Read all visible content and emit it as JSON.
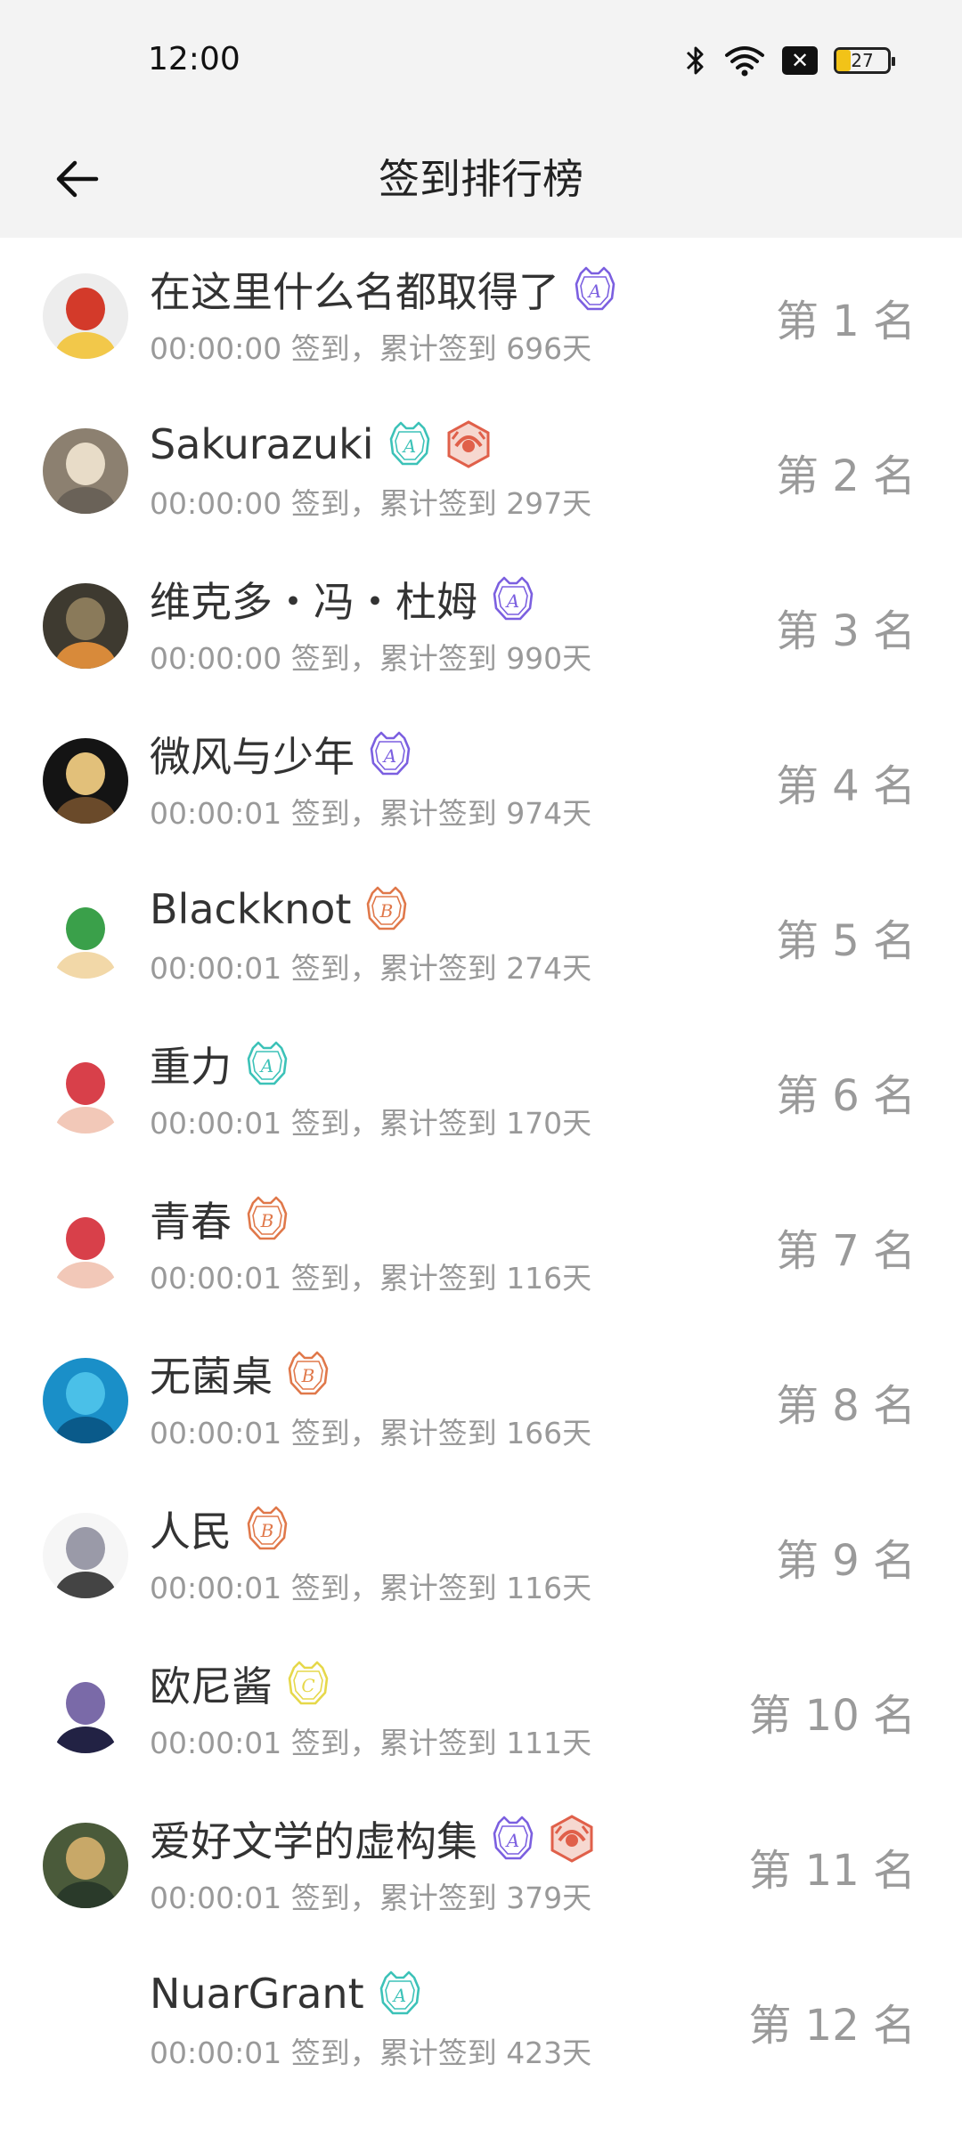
{
  "status_bar": {
    "time": "12:00",
    "battery_level": "27",
    "battery_fraction": 0.27
  },
  "header": {
    "title": "签到排行榜"
  },
  "ranking": [
    {
      "name": "在这里什么名都取得了",
      "subtitle": "00:00:00 签到，累计签到 696天",
      "rank": "第 1 名",
      "badges": [
        "purple-a-badge-icon"
      ],
      "avatar": "avatar-1"
    },
    {
      "name": "Sakurazuki",
      "subtitle": "00:00:00 签到，累计签到 297天",
      "rank": "第 2 名",
      "badges": [
        "teal-a-badge-icon",
        "red-crest-badge-icon"
      ],
      "avatar": "avatar-2"
    },
    {
      "name": "维克多・冯・杜姆",
      "subtitle": "00:00:00 签到，累计签到 990天",
      "rank": "第 3 名",
      "badges": [
        "purple-a-badge-icon"
      ],
      "avatar": "avatar-3"
    },
    {
      "name": "微风与少年",
      "subtitle": "00:00:01 签到，累计签到 974天",
      "rank": "第 4 名",
      "badges": [
        "purple-a-badge-icon"
      ],
      "avatar": "avatar-4"
    },
    {
      "name": "Blackknot",
      "subtitle": "00:00:01 签到，累计签到 274天",
      "rank": "第 5 名",
      "badges": [
        "orange-b-badge-icon"
      ],
      "avatar": "avatar-5"
    },
    {
      "name": "重力",
      "subtitle": "00:00:01 签到，累计签到 170天",
      "rank": "第 6 名",
      "badges": [
        "teal-a-badge-icon"
      ],
      "avatar": "avatar-6"
    },
    {
      "name": "青春",
      "subtitle": "00:00:01 签到，累计签到 116天",
      "rank": "第 7 名",
      "badges": [
        "orange-b-badge-icon"
      ],
      "avatar": "avatar-7"
    },
    {
      "name": "无菌桌",
      "subtitle": "00:00:01 签到，累计签到 166天",
      "rank": "第 8 名",
      "badges": [
        "orange-b-badge-icon"
      ],
      "avatar": "avatar-8"
    },
    {
      "name": "人民",
      "subtitle": "00:00:01 签到，累计签到 116天",
      "rank": "第 9 名",
      "badges": [
        "orange-b-badge-icon"
      ],
      "avatar": "avatar-9"
    },
    {
      "name": "欧尼酱",
      "subtitle": "00:00:01 签到，累计签到 111天",
      "rank": "第 10 名",
      "badges": [
        "yellow-c-badge-icon"
      ],
      "avatar": "avatar-10"
    },
    {
      "name": "爱好文学的虚构集",
      "subtitle": "00:00:01 签到，累计签到 379天",
      "rank": "第 11 名",
      "badges": [
        "purple-a-badge-icon",
        "red-crest-badge-icon"
      ],
      "avatar": "avatar-11"
    },
    {
      "name": "NuarGrant",
      "subtitle": "00:00:01 签到，累计签到 423天",
      "rank": "第 12 名",
      "badges": [
        "teal-a-badge-icon"
      ],
      "avatar": "avatar-12"
    }
  ],
  "badge_styles": {
    "purple-a-badge-icon": {
      "color": "#7b5fe0",
      "letter": "A"
    },
    "teal-a-badge-icon": {
      "color": "#3cc2b8",
      "letter": "A"
    },
    "orange-b-badge-icon": {
      "color": "#e0784a",
      "letter": "B"
    },
    "yellow-c-badge-icon": {
      "color": "#e6d84a",
      "letter": "C"
    },
    "red-crest-badge-icon": {
      "color": "#e0604a",
      "letter": ""
    }
  },
  "colors": {
    "header_bg": "#f3f3f3",
    "rank_text": "#9a9a9a",
    "subtitle_text": "#999999",
    "name_text": "#333333"
  }
}
